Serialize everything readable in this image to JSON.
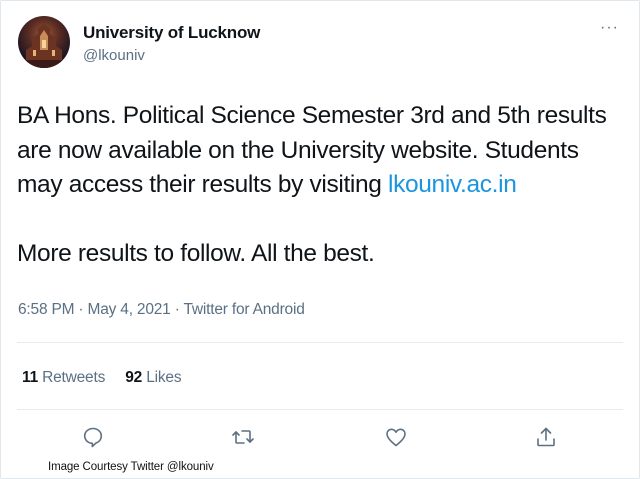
{
  "account": {
    "name": "University of Lucknow",
    "handle": "@lkouniv"
  },
  "tweet": {
    "text_part1": "BA Hons. Political Science Semester 3rd and 5th results are now available on the University website. Students may access their results by visiting ",
    "link": "lkouniv.ac.in",
    "text_part2": "More results to follow. All the best.",
    "timestamp": "6:58 PM · May 4, 2021 · Twitter for Android"
  },
  "stats": {
    "retweets_count": "11",
    "retweets_label": "Retweets",
    "likes_count": "92",
    "likes_label": "Likes"
  },
  "menu": {
    "more_symbol": "···"
  },
  "colors": {
    "link": "#1b95e0",
    "muted": "#5b7083",
    "text": "#0f1419"
  },
  "icons": [
    "reply-icon",
    "retweet-icon",
    "like-icon",
    "share-icon"
  ],
  "caption": "Image Courtesy Twitter @lkouniv"
}
